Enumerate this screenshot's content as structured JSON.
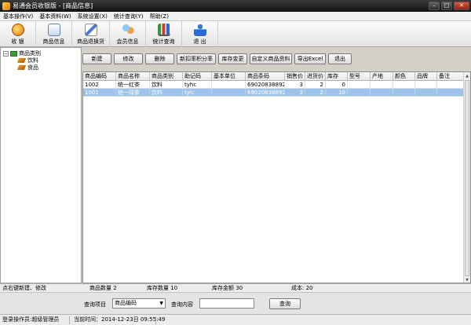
{
  "window": {
    "title": "易通会员收银版 - [商品信息]",
    "btn_min": "–",
    "btn_max": "□",
    "btn_close": "✕"
  },
  "menu": [
    "基本操作(V)",
    "基本资料(W)",
    "系统设置(X)",
    "统计查询(Y)",
    "帮助(Z)"
  ],
  "toolbar": [
    {
      "label": "收 银",
      "icon": "coin-icon"
    },
    {
      "label": "商品信息",
      "icon": "card-icon"
    },
    {
      "label": "商品退换货",
      "icon": "pen-icon"
    },
    {
      "label": "会员信息",
      "icon": "users-icon"
    },
    {
      "label": "统计查询",
      "icon": "chart-icon"
    },
    {
      "label": "退 出",
      "icon": "exit-icon"
    }
  ],
  "tree": {
    "root": "商品类别",
    "toggle": "−",
    "children": [
      "饮料",
      "食品"
    ]
  },
  "actions": [
    "新建",
    "修改",
    "删除",
    "新扣率积分率",
    "库存变更",
    "自定义商品资料",
    "导出Excel",
    "退出"
  ],
  "grid": {
    "columns": [
      "商品编码",
      "商品名称",
      "商品类别",
      "助记码",
      "基本单位",
      "商品条码",
      "销售价",
      "进货价",
      "库存",
      "型号",
      "产地",
      "颜色",
      "品牌",
      "备注"
    ],
    "rows": [
      [
        "1002",
        "统一红茶",
        "饮料",
        "tyhc",
        "",
        "6902083889296",
        "3",
        "2",
        "0",
        "",
        "",
        "",
        "",
        ""
      ],
      [
        "1001",
        "统一绿茶",
        "饮料",
        "tylc",
        "",
        "6902083889296",
        "3",
        "2",
        "10",
        "",
        "",
        "",
        "",
        ""
      ]
    ],
    "selected_row": 1,
    "scroll_up": "▲",
    "scroll_down": "▼"
  },
  "summary": {
    "hint": "点右键新建、修改",
    "count": "商品数量 2",
    "stock": "库存数量 10",
    "amount": "库存金额 30",
    "cost": "成本: 20"
  },
  "query": {
    "item_label": "查询项目",
    "item_value": "商品编码",
    "caret": "▼",
    "content_label": "查询内容",
    "content_value": "",
    "button": "查询"
  },
  "status": {
    "operator": "登录操作员:超级管理员",
    "time": "当前时间：2014-12-23日 09:55:49"
  }
}
